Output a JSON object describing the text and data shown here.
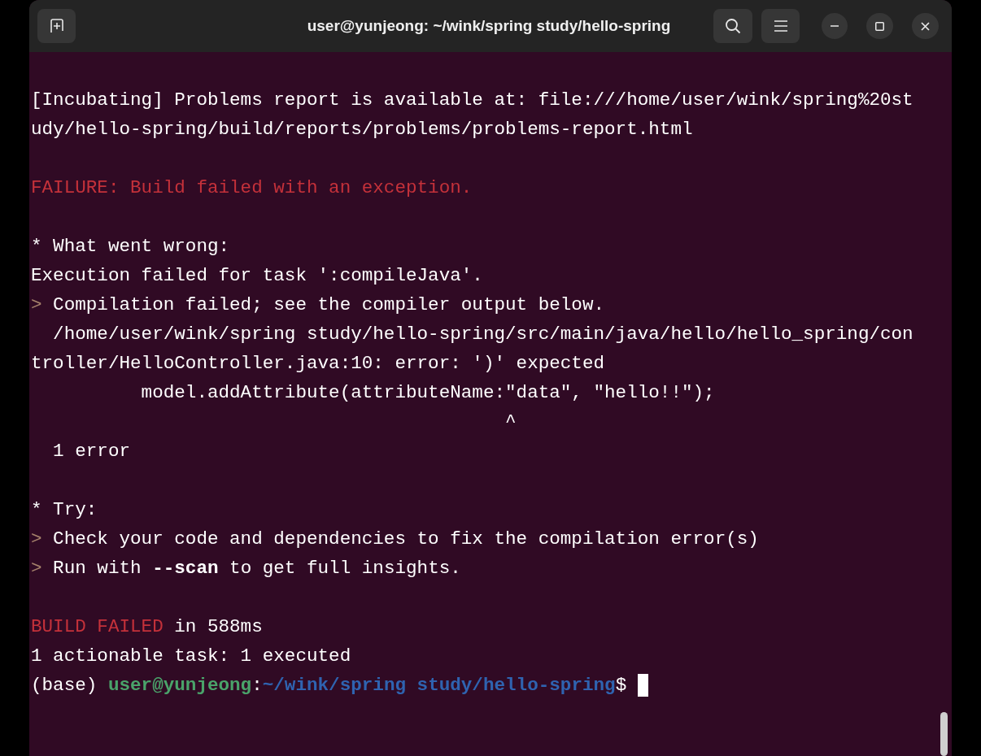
{
  "window": {
    "title": "user@yunjeong: ~/wink/spring study/hello-spring"
  },
  "terminal": {
    "cursor_visible": true,
    "lines": [
      {
        "kind": "blank"
      },
      {
        "kind": "text",
        "segments": [
          {
            "text": "[Incubating] Problems report is available at: file:///home/user/wink/spring%20st",
            "kind": "plain"
          }
        ]
      },
      {
        "kind": "text",
        "segments": [
          {
            "text": "udy/hello-spring/build/reports/problems/problems-report.html",
            "kind": "plain"
          }
        ]
      },
      {
        "kind": "blank"
      },
      {
        "kind": "text",
        "segments": [
          {
            "text": "FAILURE: Build failed with an exception.",
            "kind": "error"
          }
        ]
      },
      {
        "kind": "blank"
      },
      {
        "kind": "text",
        "segments": [
          {
            "text": "* What went wrong:",
            "kind": "plain"
          }
        ]
      },
      {
        "kind": "text",
        "segments": [
          {
            "text": "Execution failed for task ':compileJava'.",
            "kind": "plain"
          }
        ]
      },
      {
        "kind": "text",
        "segments": [
          {
            "text": ">",
            "kind": "marker"
          },
          {
            "text": " Compilation failed; see the compiler output below.",
            "kind": "plain"
          }
        ]
      },
      {
        "kind": "text",
        "segments": [
          {
            "text": "  /home/user/wink/spring study/hello-spring/src/main/java/hello/hello_spring/con",
            "kind": "plain"
          }
        ]
      },
      {
        "kind": "text",
        "segments": [
          {
            "text": "troller/HelloController.java:10: error: ')' expected",
            "kind": "plain"
          }
        ]
      },
      {
        "kind": "text",
        "segments": [
          {
            "text": "          model.addAttribute(attributeName:\"data\", \"hello!!\");",
            "kind": "plain"
          }
        ]
      },
      {
        "kind": "text",
        "segments": [
          {
            "text": "                                           ^",
            "kind": "plain"
          }
        ]
      },
      {
        "kind": "text",
        "segments": [
          {
            "text": "  1 error",
            "kind": "plain"
          }
        ]
      },
      {
        "kind": "blank"
      },
      {
        "kind": "text",
        "segments": [
          {
            "text": "* Try:",
            "kind": "plain"
          }
        ]
      },
      {
        "kind": "text",
        "segments": [
          {
            "text": ">",
            "kind": "marker"
          },
          {
            "text": " Check your code and dependencies to fix the compilation error(s)",
            "kind": "plain"
          }
        ]
      },
      {
        "kind": "text",
        "segments": [
          {
            "text": ">",
            "kind": "marker"
          },
          {
            "text": " Run with ",
            "kind": "plain"
          },
          {
            "text": "--scan",
            "kind": "bold"
          },
          {
            "text": " to get full insights.",
            "kind": "plain"
          }
        ]
      },
      {
        "kind": "blank"
      },
      {
        "kind": "text",
        "segments": [
          {
            "text": "BUILD FAILED",
            "kind": "error"
          },
          {
            "text": " in 588ms",
            "kind": "plain"
          }
        ]
      },
      {
        "kind": "text",
        "segments": [
          {
            "text": "1 actionable task: 1 executed",
            "kind": "plain"
          }
        ]
      },
      {
        "kind": "text",
        "segments": [
          {
            "text": "(base) ",
            "kind": "plain"
          },
          {
            "text": "user@yunjeong",
            "kind": "user"
          },
          {
            "text": ":",
            "kind": "plain"
          },
          {
            "text": "~/wink/spring study/hello-spring",
            "kind": "path"
          },
          {
            "text": "$ ",
            "kind": "plain"
          }
        ]
      }
    ]
  }
}
